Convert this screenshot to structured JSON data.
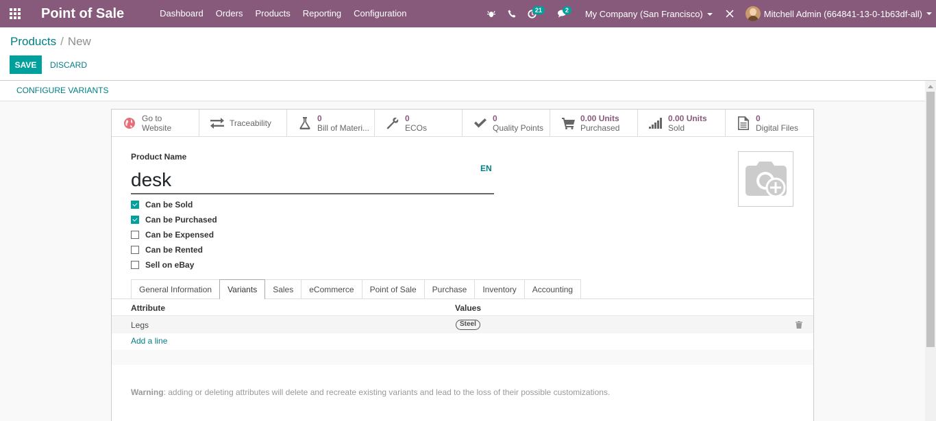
{
  "navbar": {
    "app_name": "Point of Sale",
    "menu": [
      "Dashboard",
      "Orders",
      "Products",
      "Reporting",
      "Configuration"
    ],
    "activity_count": "21",
    "message_count": "2",
    "company": "My Company (San Francisco)",
    "user": "Mitchell Admin (664841-13-0-1b63df-all)",
    "bg_color": "#875a7b"
  },
  "breadcrumb": {
    "parent": "Products",
    "separator": "/",
    "current": "New"
  },
  "actions": {
    "save": "SAVE",
    "discard": "DISCARD"
  },
  "statusbar": {
    "configure_variants": "CONFIGURE VARIANTS"
  },
  "smart_buttons": [
    {
      "num": "Go to",
      "label": "Website",
      "icon": "globe-icon"
    },
    {
      "num": "",
      "label": "Traceability",
      "icon": "arrows-exchange-icon"
    },
    {
      "num": "0",
      "label": "Bill of Materi...",
      "icon": "flask-icon"
    },
    {
      "num": "0",
      "label": "ECOs",
      "icon": "wrench-icon"
    },
    {
      "num": "0",
      "label": "Quality Points",
      "icon": "check-icon"
    },
    {
      "num": "0.00 Units",
      "label": "Purchased",
      "icon": "cart-icon"
    },
    {
      "num": "0.00 Units",
      "label": "Sold",
      "icon": "signal-icon"
    },
    {
      "num": "0",
      "label": "Digital Files",
      "icon": "file-icon"
    }
  ],
  "form": {
    "product_name_label": "Product Name",
    "product_name_value": "desk",
    "lang": "EN",
    "checkboxes": [
      {
        "label": "Can be Sold",
        "checked": true
      },
      {
        "label": "Can be Purchased",
        "checked": true
      },
      {
        "label": "Can be Expensed",
        "checked": false
      },
      {
        "label": "Can be Rented",
        "checked": false
      },
      {
        "label": "Sell on eBay",
        "checked": false
      }
    ]
  },
  "tabs": [
    "General Information",
    "Variants",
    "Sales",
    "eCommerce",
    "Point of Sale",
    "Purchase",
    "Inventory",
    "Accounting"
  ],
  "active_tab": "Variants",
  "variants": {
    "columns": [
      "Attribute",
      "Values"
    ],
    "rows": [
      {
        "attribute": "Legs",
        "values": [
          "Steel"
        ]
      }
    ],
    "add_line": "Add a line",
    "warning_bold": "Warning",
    "warning_text": ": adding or deleting attributes will delete and recreate existing variants and lead to the loss of their possible customizations."
  }
}
